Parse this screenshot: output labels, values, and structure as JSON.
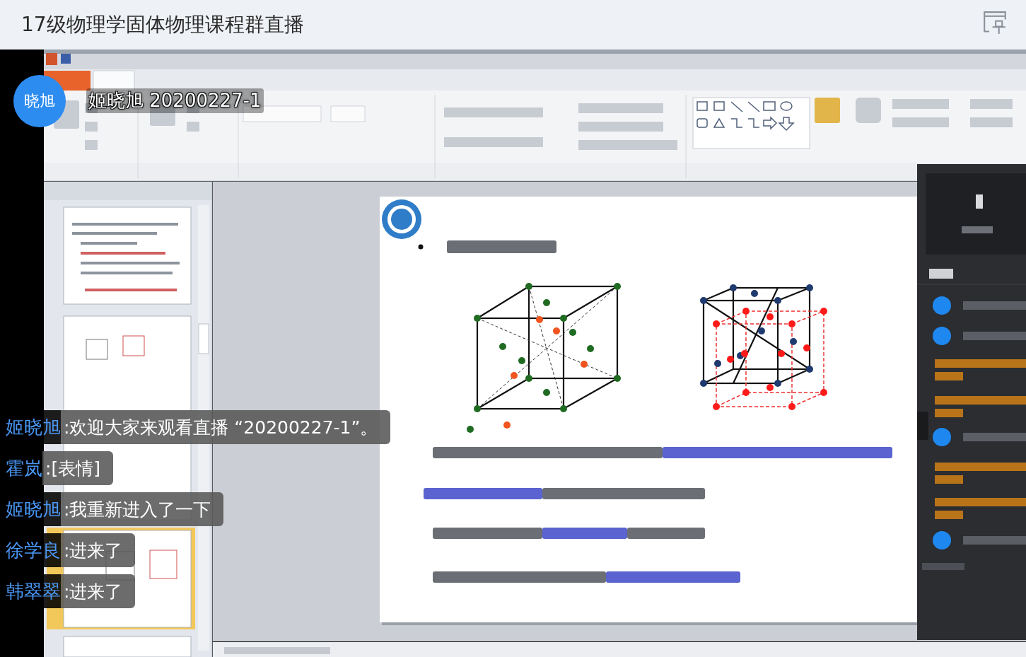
{
  "window": {
    "title": "17级物理学固体物理课程群直播"
  },
  "stream": {
    "host_avatar": "晓旭",
    "host_name": "姬晓旭 20200227-1"
  },
  "chat": [
    {
      "user": "姬晓旭",
      "text": ":欢迎大家来观看直播 “20200227-1”。"
    },
    {
      "user": "霍岚",
      "text": ":[表情]"
    },
    {
      "user": "姬晓旭",
      "text": ":我重新进入了一下"
    },
    {
      "user": "徐学良",
      "text": ":进来了"
    },
    {
      "user": "韩翠翠",
      "text": ":进来了"
    }
  ]
}
